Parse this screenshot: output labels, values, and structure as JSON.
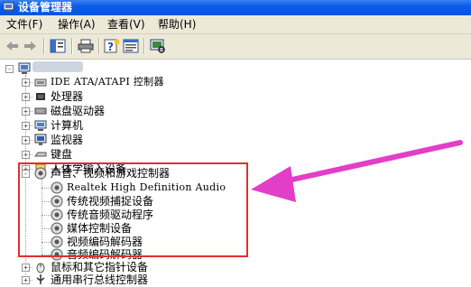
{
  "window": {
    "title": "设备管理器"
  },
  "menu": [
    "文件(F)",
    "操作(A)",
    "查看(V)",
    "帮助(H)"
  ],
  "toolbar": {
    "buttons": [
      "back-icon",
      "forward-icon",
      "console-tree-icon",
      "print-icon",
      "help-icon",
      "properties-icon",
      "scan-hardware-icon"
    ]
  },
  "tree": {
    "categories": [
      {
        "label": "IDE ATA/ATAPI 控制器",
        "icon": "ide-controller-icon",
        "expander": "+"
      },
      {
        "label": "处理器",
        "icon": "processor-icon",
        "expander": "+"
      },
      {
        "label": "磁盘驱动器",
        "icon": "disk-drive-icon",
        "expander": "+"
      },
      {
        "label": "计算机",
        "icon": "computer-icon",
        "expander": "+"
      },
      {
        "label": "监视器",
        "icon": "monitor-icon",
        "expander": "+"
      },
      {
        "label": "键盘",
        "icon": "keyboard-icon",
        "expander": "+"
      },
      {
        "label": "人体学输入设备",
        "icon": "hid-icon",
        "expander": "+"
      }
    ],
    "sound_category": {
      "label": "声音、视频和游戏控制器",
      "expander": "-",
      "children": [
        "Realtek High Definition Audio",
        "传统视频捕捉设备",
        "传统音频驱动程序",
        "媒体控制设备",
        "视频编码解码器",
        "音频编码解码器"
      ]
    },
    "after": [
      {
        "label": "鼠标和其它指针设备",
        "icon": "mouse-icon",
        "expander": "+"
      },
      {
        "label": "通用串行总线控制器",
        "icon": "usb-icon",
        "expander": "+"
      }
    ]
  },
  "colors": {
    "highlight": "#e0302d",
    "arrow": "#e23ec8",
    "titlebar": "#0a5ce8"
  }
}
